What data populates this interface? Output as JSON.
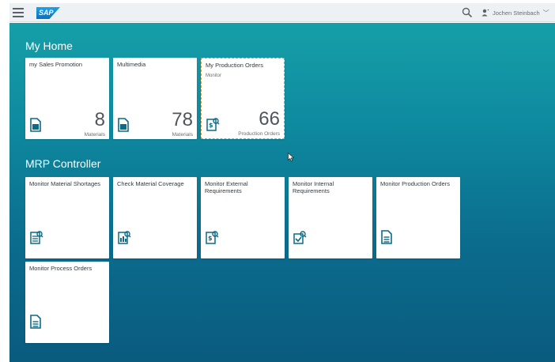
{
  "header": {
    "logo_text": "SAP",
    "user_name": "Jochen Steinbach"
  },
  "groups": [
    {
      "title": "My Home",
      "tiles": [
        {
          "title": "my Sales Promotion",
          "subtitle": "",
          "number": "8",
          "unit": "Materials",
          "icon": "document-icon"
        },
        {
          "title": "Multimedia",
          "subtitle": "",
          "number": "78",
          "unit": "Materials",
          "icon": "document-icon"
        },
        {
          "title": "My Production Orders",
          "subtitle": "Monitor",
          "number": "66",
          "unit": "Production Orders",
          "icon": "money-search-icon"
        }
      ]
    },
    {
      "title": "MRP Controller",
      "tiles": [
        {
          "title": "Monitor Material Shortages",
          "icon": "list-search-icon"
        },
        {
          "title": "Check Material Coverage",
          "icon": "chart-search-icon"
        },
        {
          "title": "Monitor External Requirements",
          "icon": "money-search-icon"
        },
        {
          "title": "Monitor Internal Requirements",
          "icon": "check-search-icon"
        },
        {
          "title": "Monitor Production Orders",
          "icon": "document-icon"
        },
        {
          "title": "Monitor Process Orders",
          "icon": "document-icon"
        }
      ]
    }
  ],
  "colors": {
    "accent": "#1aa3e8",
    "background_top": "#169fa8",
    "background_bottom": "#0a5b7e",
    "icon": "#0a6a8a"
  }
}
